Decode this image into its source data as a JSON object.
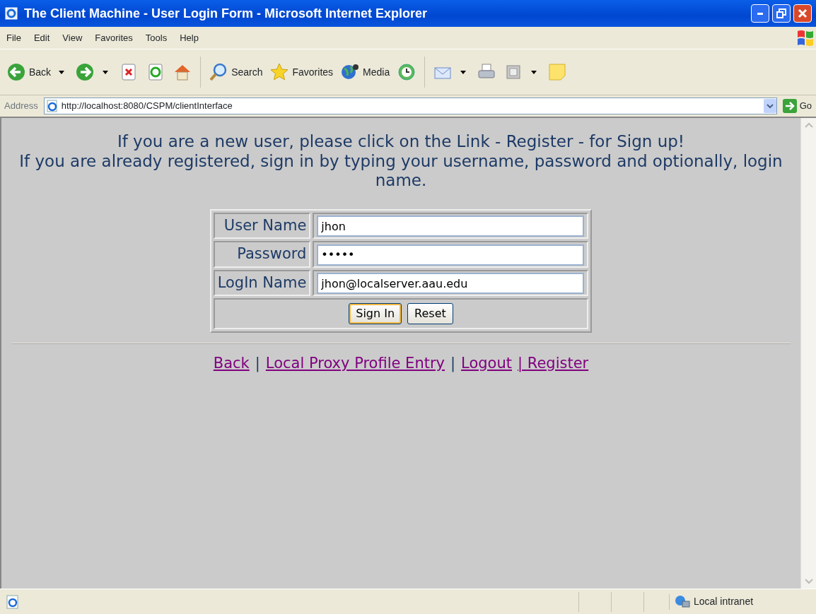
{
  "window": {
    "title": "The Client Machine - User Login Form - Microsoft Internet Explorer"
  },
  "menu": [
    "File",
    "Edit",
    "View",
    "Favorites",
    "Tools",
    "Help"
  ],
  "toolbar": [
    {
      "kind": "back",
      "label": "Back",
      "dropdown": true
    },
    {
      "kind": "forward",
      "dropdown": true
    },
    {
      "kind": "stop"
    },
    {
      "kind": "refresh"
    },
    {
      "kind": "home"
    },
    {
      "kind": "search",
      "label": "Search"
    },
    {
      "kind": "favorites",
      "label": "Favorites"
    },
    {
      "kind": "media",
      "label": "Media"
    },
    {
      "kind": "history"
    },
    {
      "kind": "mail",
      "dropdown": true
    },
    {
      "kind": "print"
    },
    {
      "kind": "edit",
      "dropdown": true
    },
    {
      "kind": "note"
    }
  ],
  "address_bar": {
    "label": "Address",
    "url": "http://localhost:8080/CSPM/clientInterface",
    "go": "Go"
  },
  "page": {
    "intro": [
      "If you are a new user, please click on the Link - Register - for Sign up!",
      "If you are already registered, sign in by typing your username, password and optionally, login name."
    ],
    "form": {
      "fields": [
        {
          "label": "User Name",
          "value": "jhon"
        },
        {
          "label": "Password",
          "value": "•••••"
        },
        {
          "label": "LogIn Name",
          "value": "jhon@localserver.aau.edu"
        }
      ],
      "buttons": [
        {
          "label": "Sign In",
          "focused": true
        },
        {
          "label": "Reset",
          "focused": false
        }
      ]
    },
    "links": [
      {
        "kind": "link",
        "text": "Back"
      },
      {
        "kind": "separator",
        "text": "|"
      },
      {
        "kind": "link",
        "text": "Local Proxy Profile Entry"
      },
      {
        "kind": "separator",
        "text": "|"
      },
      {
        "kind": "link",
        "text": "Logout"
      },
      {
        "kind": "link",
        "text": "| Register"
      }
    ]
  },
  "status_bar": {
    "zone": "Local intranet"
  }
}
